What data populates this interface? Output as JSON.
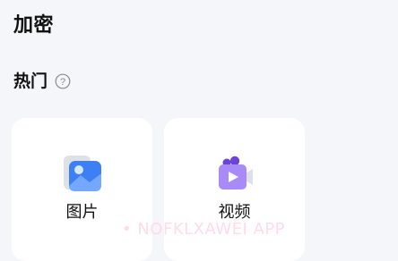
{
  "header": {
    "title": "加密"
  },
  "section": {
    "title": "热门",
    "help_icon": "help-circle-icon"
  },
  "cards": [
    {
      "label": "图片",
      "icon": "image-icon",
      "accent": "#3d7ff5"
    },
    {
      "label": "视频",
      "icon": "video-icon",
      "accent": "#8e63f0"
    }
  ],
  "watermark": {
    "text": "• NOFKLXAWEI APP"
  },
  "colors": {
    "background": "#f5f6fa",
    "card": "#ffffff",
    "text": "#111111",
    "watermark": "#ffd6e2"
  }
}
